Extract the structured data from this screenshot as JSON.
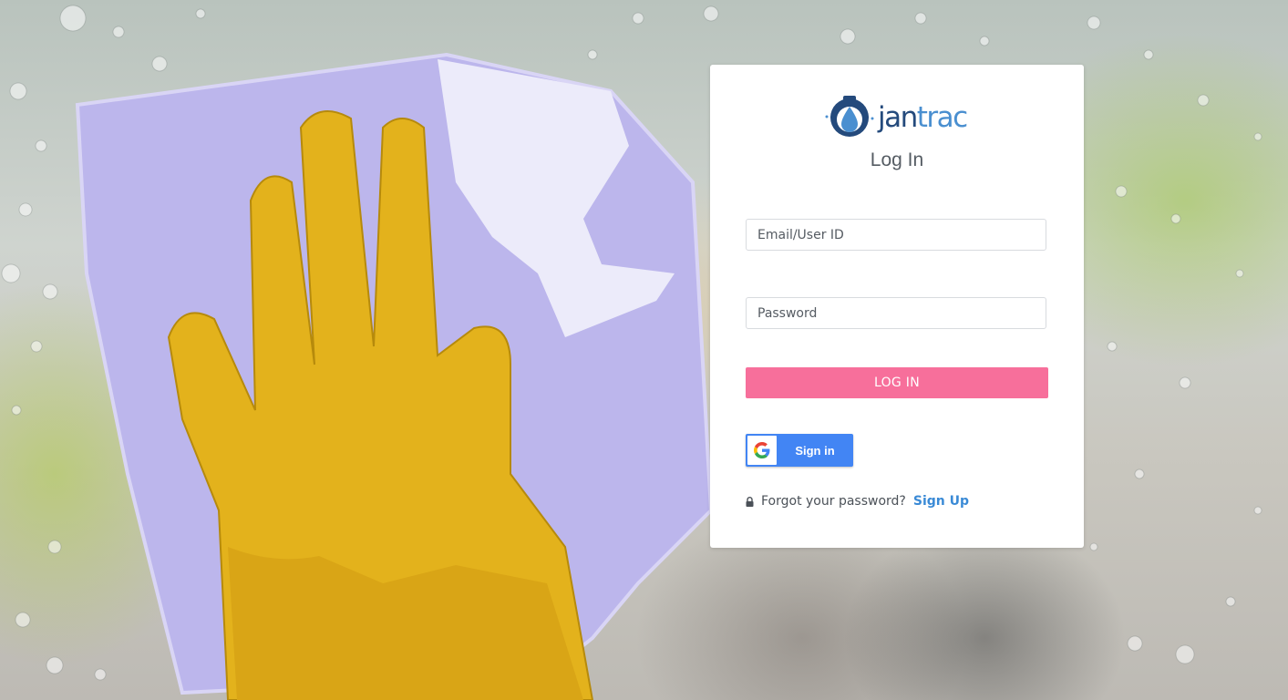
{
  "brand": {
    "name_part1": "jan",
    "name_part2": "trac",
    "logo_icon": "water-drop-camera-icon",
    "colors": {
      "dark": "#244a7c",
      "light": "#4a8fd0"
    }
  },
  "login_form": {
    "title": "Log In",
    "email_placeholder": "Email/User ID",
    "password_placeholder": "Password",
    "login_label": "LOG IN",
    "google_label": "Sign in",
    "forgot_text": "Forgot your password?",
    "signup_text": "Sign Up"
  },
  "colors": {
    "login_button": "#f76f9b",
    "google_button": "#4285f4",
    "signup_link": "#3a8ad6"
  },
  "background": {
    "description_icon": "gloved-hand-cleaning-window-image"
  }
}
